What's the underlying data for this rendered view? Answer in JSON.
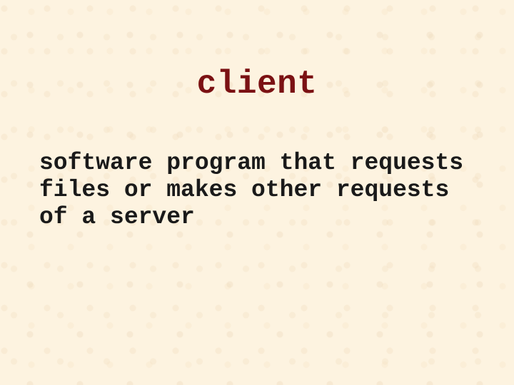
{
  "slide": {
    "title": "client",
    "definition": "software program that requests files or makes other requests of a server"
  },
  "colors": {
    "title": "#7b1113",
    "bodyText": "#1a1a1a",
    "background": "#fdf3e0"
  }
}
